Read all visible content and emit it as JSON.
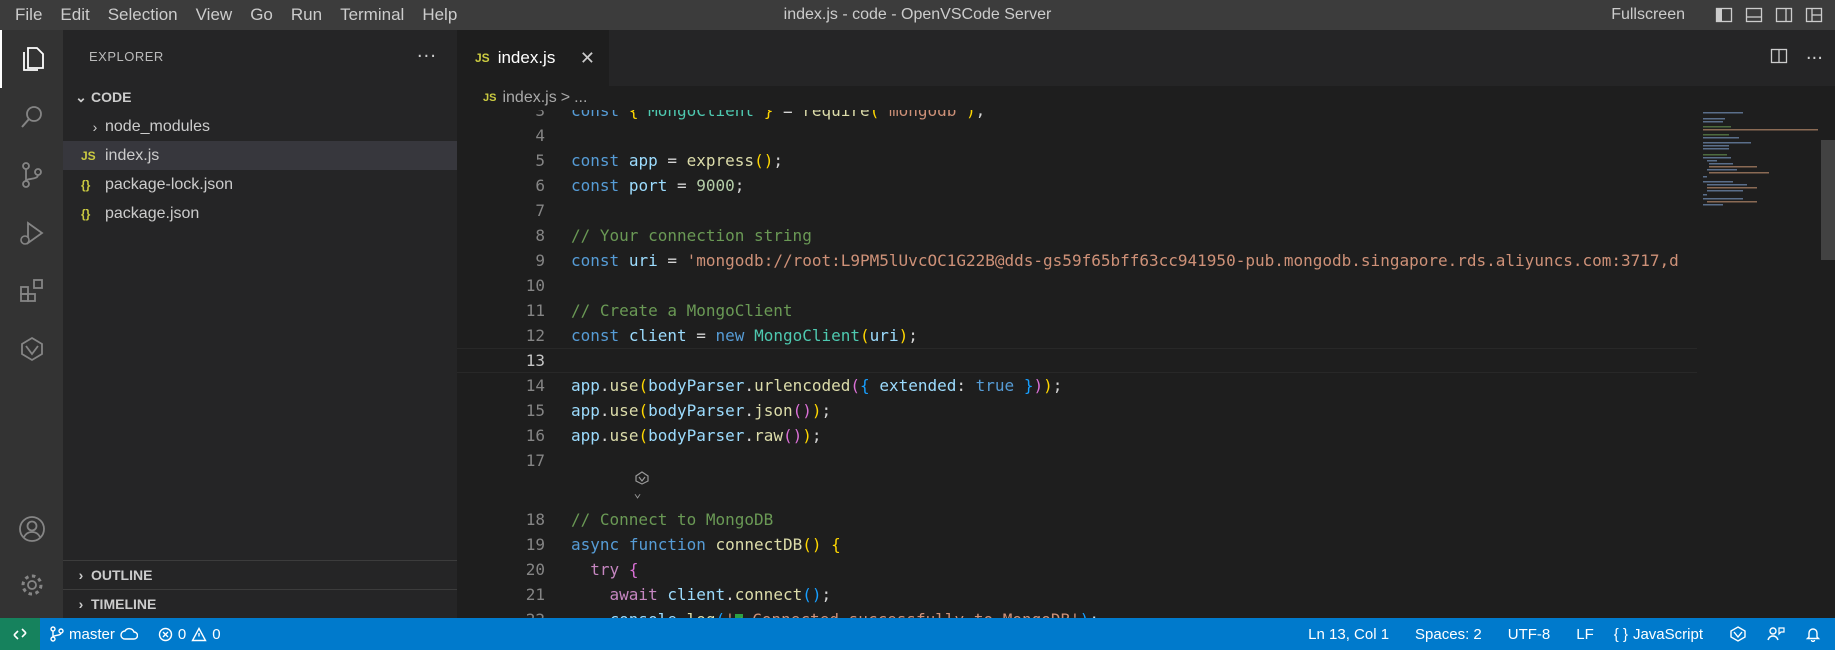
{
  "titlebar": {
    "menu": [
      "File",
      "Edit",
      "Selection",
      "View",
      "Go",
      "Run",
      "Terminal",
      "Help"
    ],
    "window_title": "index.js - code - OpenVSCode Server",
    "fullscreen": "Fullscreen"
  },
  "sidebar": {
    "title": "EXPLORER",
    "more": "···",
    "root_folder": "CODE",
    "items": [
      {
        "label": "node_modules",
        "type": "folder"
      },
      {
        "label": "index.js",
        "type": "js",
        "selected": true
      },
      {
        "label": "package-lock.json",
        "type": "json"
      },
      {
        "label": "package.json",
        "type": "json"
      }
    ],
    "outline": "OUTLINE",
    "timeline": "TIMELINE",
    "file_badge_js": "JS",
    "file_badge_json": "{}"
  },
  "editor": {
    "tab_label": "index.js",
    "tab_badge": "JS",
    "breadcrumb_file": "index.js",
    "breadcrumb_sep": ">",
    "breadcrumb_more": "...",
    "lines": [
      {
        "n": "3",
        "text": "const { MongoClient } = require('mongodb');"
      },
      {
        "n": "4",
        "text": ""
      },
      {
        "n": "5",
        "text": "const app = express();"
      },
      {
        "n": "6",
        "text": "const port = 9000;"
      },
      {
        "n": "7",
        "text": ""
      },
      {
        "n": "8",
        "text": "// Your connection string"
      },
      {
        "n": "9",
        "text": "const uri = 'mongodb://root:L9PM5lUvcOC1G22B@dds-gs59f65bff63cc941950-pub.mongodb.singapore.rds.aliyuncs.com:3717,d"
      },
      {
        "n": "10",
        "text": ""
      },
      {
        "n": "11",
        "text": "// Create a MongoClient"
      },
      {
        "n": "12",
        "text": "const client = new MongoClient(uri);"
      },
      {
        "n": "13",
        "text": ""
      },
      {
        "n": "14",
        "text": "app.use(bodyParser.urlencoded({ extended: true }));"
      },
      {
        "n": "15",
        "text": "app.use(bodyParser.json());"
      },
      {
        "n": "16",
        "text": "app.use(bodyParser.raw());"
      },
      {
        "n": "17",
        "text": ""
      },
      {
        "n": "18",
        "text": "// Connect to MongoDB"
      },
      {
        "n": "19",
        "text": "async function connectDB() {"
      },
      {
        "n": "20",
        "text": "  try {"
      },
      {
        "n": "21",
        "text": "    await client.connect();"
      },
      {
        "n": "22",
        "text": "    console.log('✅ Connected successfully to MongoDB');"
      }
    ]
  },
  "statusbar": {
    "branch": "master",
    "errors": "0",
    "warnings": "0",
    "position": "Ln 13, Col 1",
    "spaces": "Spaces: 2",
    "encoding": "UTF-8",
    "eol": "LF",
    "language_badge": "{ }",
    "language": "JavaScript"
  },
  "colors": {
    "statusbar": "#007acc",
    "remote": "#16825d",
    "activitybar": "#333333",
    "sidebar": "#252526",
    "editor": "#1e1e1e"
  }
}
